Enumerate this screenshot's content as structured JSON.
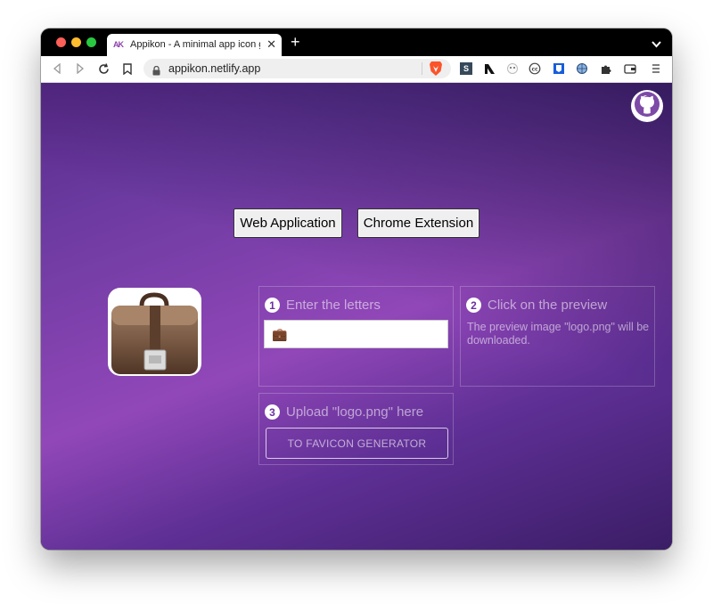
{
  "browser": {
    "tab": {
      "favicon_text": "AK",
      "title": "Appikon - A minimal app icon generator",
      "close_glyph": "✕"
    },
    "new_tab_glyph": "+",
    "url": "appikon.netlify.app",
    "extensions": [
      "S",
      "N"
    ]
  },
  "page": {
    "mode_buttons": {
      "web": "Web Application",
      "chrome": "Chrome Extension"
    },
    "steps": [
      {
        "number": "1",
        "title": "Enter the letters"
      },
      {
        "number": "2",
        "title": "Click on the preview",
        "description": "The preview image \"logo.png\" will be downloaded."
      },
      {
        "number": "3",
        "title": "Upload \"logo.png\" here",
        "button": "TO FAVICON GENERATOR"
      }
    ],
    "letters_value": "💼"
  },
  "colors": {
    "gradient_light": "#9147b8",
    "gradient_dark": "#3b1d66",
    "step_number_text": "#6b2fa0"
  }
}
